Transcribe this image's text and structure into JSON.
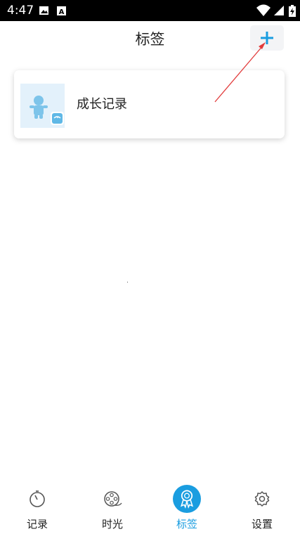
{
  "status_bar": {
    "time": "4:47",
    "icons": [
      "image-icon",
      "a-badge-icon",
      "wifi-icon",
      "signal-icon",
      "battery-charging-icon"
    ]
  },
  "header": {
    "title": "标签",
    "add_icon": "plus-icon"
  },
  "tags": [
    {
      "label": "成长记录",
      "icon": "baby-scale-icon"
    }
  ],
  "bottom_nav": {
    "items": [
      {
        "label": "记录",
        "icon": "stopwatch-icon",
        "active": false
      },
      {
        "label": "时光",
        "icon": "film-reel-icon",
        "active": false
      },
      {
        "label": "标签",
        "icon": "award-ribbon-icon",
        "active": true
      },
      {
        "label": "设置",
        "icon": "gear-icon",
        "active": false
      }
    ]
  },
  "colors": {
    "accent": "#1a9de0",
    "thumb_bg": "#e3f1fb",
    "annotation_arrow": "#e23b3b"
  }
}
